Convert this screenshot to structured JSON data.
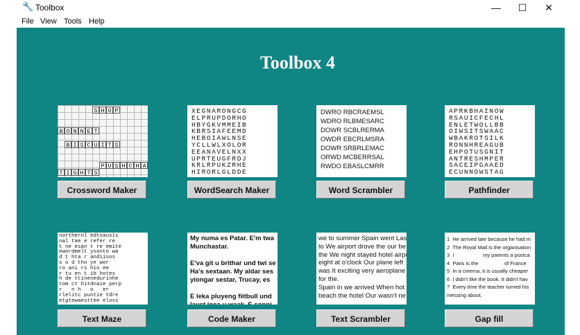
{
  "window": {
    "title": "Toolbox",
    "minimize": "—",
    "maximize": "☐",
    "close": "✕"
  },
  "menu": [
    "File",
    "View",
    "Tools",
    "Help"
  ],
  "app_title": "Toolbox 4",
  "colors": {
    "background": "#0f8584",
    "button": "#d4d4d4",
    "title": "#ffffff"
  },
  "tools": [
    {
      "label": "Crossword Maker"
    },
    {
      "label": "WordSearch Maker"
    },
    {
      "label": "Word Scrambler"
    },
    {
      "label": "Pathfinder"
    },
    {
      "label": "Text Maze"
    },
    {
      "label": "Code Maker"
    },
    {
      "label": "Text Scrambler"
    },
    {
      "label": "Gap fill"
    }
  ],
  "crossword_words": [
    "SHOP",
    "BONNET",
    "BISCUITS",
    "PUSHCHA",
    "TIGHTS"
  ],
  "wordsearch_rows": [
    "XEGNARONGCG",
    "ELPRUPDORHO",
    "HBYGKVMMEIB",
    "KBRSIAFEEMD",
    "HEBOIAWLNSE",
    "YCLLWLXOLOR",
    "EEANAVELNXX",
    "UPRTEUGFRDJ",
    "KRLRPUKZRHE",
    "HIRORLGLDDE"
  ],
  "scrambled_words": [
    "DWRO RBCRAEMSL",
    "WDRO RLBMESARC",
    "DOWR SCBLRERMA",
    "OWDR EBCRLMSRA",
    "DOWR SRBRLEMAC",
    "ORWD MCBERRSAL",
    "RWDO EBASLCMRR"
  ],
  "pathfinder_rows": [
    "APRKBHAINOW",
    "RSAUICFECHL",
    "ENLETWOLLBB",
    "OIWSITSWAAC",
    "WBAKROTSILK",
    "RONNHREAGUB",
    "EHPOTUSGNIT",
    "ANTRESHMPER",
    "SACEIPGAAED",
    "ECUNNOWSTAG"
  ],
  "maze_rows": [
    "northernl edtoausis",
    "nal tae e refer re",
    "t ne esan t re emite",
    "ewordmelt ysonto wa",
    "d t hta r andiisos",
    "s o d tho ye wor",
    "ro ani rs hio ee",
    "r tu en t ib hotes",
    "h de ttinenedurinhe",
    "tom ct hitdnaie perp",
    "r   n h   o   er",
    "rlelitc puntie tdre",
    "etgtewaesttee eloss"
  ],
  "code_lines": [
    "My numa es Patar. E'm twa",
    "Munchastar.",
    "",
    "E'va git u brithar und twi se",
    "Ha's sextaan. My aldar ses",
    "yiongar sestar, Trucay, es",
    "",
    "E leka pluyeng fiitbull und",
    "laust inca u waak. E soppi"
  ],
  "scrambler_lines": [
    "we to summer Spain went Last",
    "to We airport drove the our be",
    "the We night stayed hotel airpo",
    "eight at o'clock Our plane left",
    "was It exciting very aeroplane",
    "for the.",
    "Spain in we arrived When hot v",
    "beach the hotel Our wasn't ne"
  ],
  "gapfill_lines": [
    "1  He arrived late because he had m",
    "2  The Royal Mail is the organisation",
    "3  I                    my parents a postca",
    "4  Paris is the                  of France",
    "5  In a cinema, it is usually cheaper",
    "6  I didn't like the book. It didn't hav",
    "7  Every time the teacher turned his",
    "messing about."
  ]
}
